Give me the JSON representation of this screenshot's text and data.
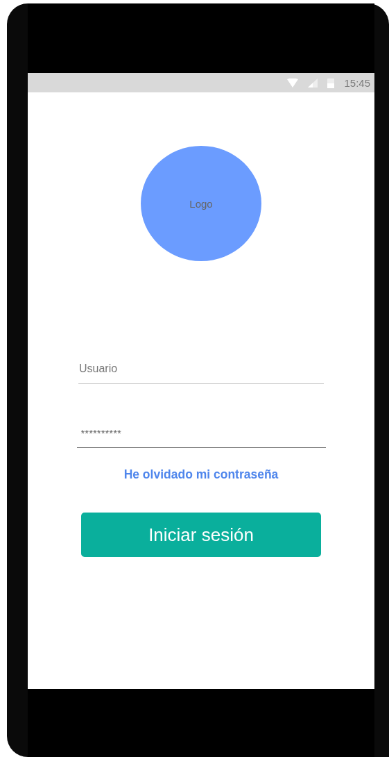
{
  "status_bar": {
    "time": "15:45"
  },
  "logo": {
    "label": "Logo"
  },
  "username": {
    "placeholder": "Usuario"
  },
  "password": {
    "value": "**********"
  },
  "forgot_link": "He olvidado mi contraseña",
  "login_button": "Iniciar sesión"
}
